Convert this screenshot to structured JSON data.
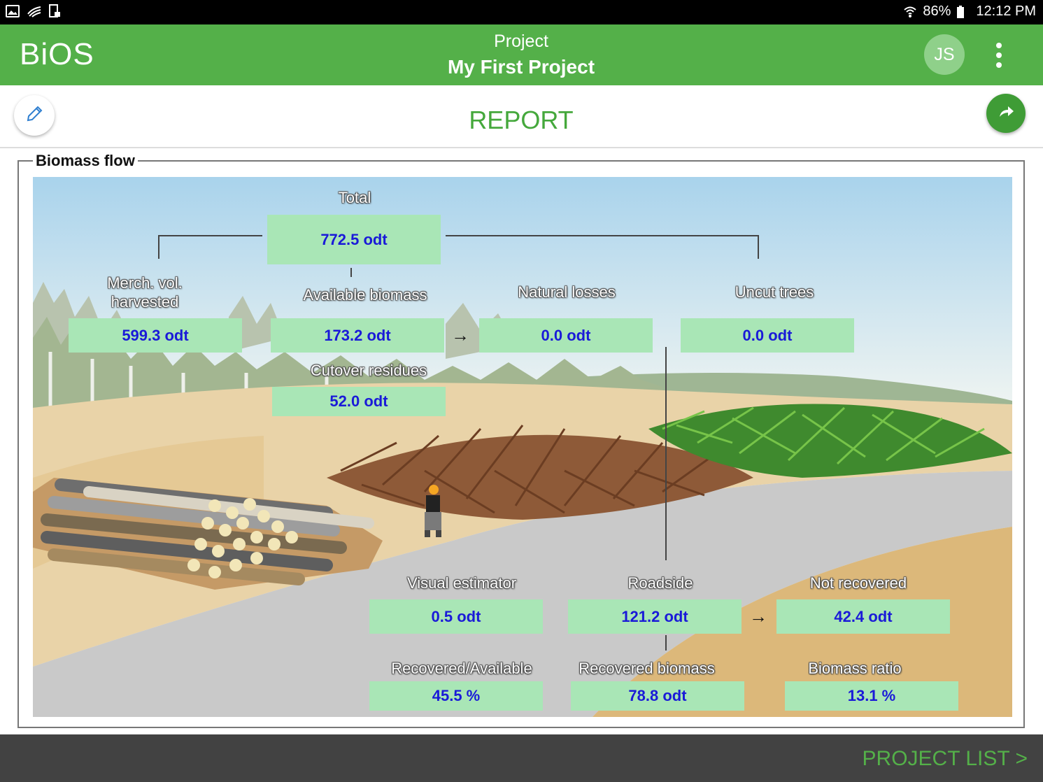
{
  "status_bar": {
    "battery": "86%",
    "time": "12:12 PM"
  },
  "app_bar": {
    "brand": "BiOS",
    "subtitle": "Project",
    "project_name": "My First Project",
    "avatar_initials": "JS"
  },
  "sub_header": {
    "title": "REPORT"
  },
  "panel": {
    "legend": "Biomass flow"
  },
  "flow": {
    "total": {
      "label": "Total",
      "value": "772.5 odt"
    },
    "merch": {
      "label": "Merch. vol. harvested",
      "value": "599.3 odt"
    },
    "available": {
      "label": "Available biomass",
      "value": "173.2 odt"
    },
    "natural_losses": {
      "label": "Natural losses",
      "value": "0.0 odt"
    },
    "uncut": {
      "label": "Uncut trees",
      "value": "0.0 odt"
    },
    "cutover": {
      "label": "Cutover residues",
      "value": "52.0 odt"
    },
    "visual": {
      "label": "Visual estimator",
      "value": "0.5 odt"
    },
    "roadside": {
      "label": "Roadside",
      "value": "121.2 odt"
    },
    "not_recovered": {
      "label": "Not recovered",
      "value": "42.4 odt"
    },
    "recovered_available": {
      "label": "Recovered/Available",
      "value": "45.5 %"
    },
    "recovered_biomass": {
      "label": "Recovered biomass",
      "value": "78.8 odt"
    },
    "biomass_ratio": {
      "label": "Biomass ratio",
      "value": "13.1 %"
    },
    "arrow": "→"
  },
  "bottom_bar": {
    "project_list": "PROJECT LIST >"
  },
  "colors": {
    "green": "#54b049",
    "value_bg": "#a9e6b6",
    "value_text": "#1a1ad8"
  }
}
